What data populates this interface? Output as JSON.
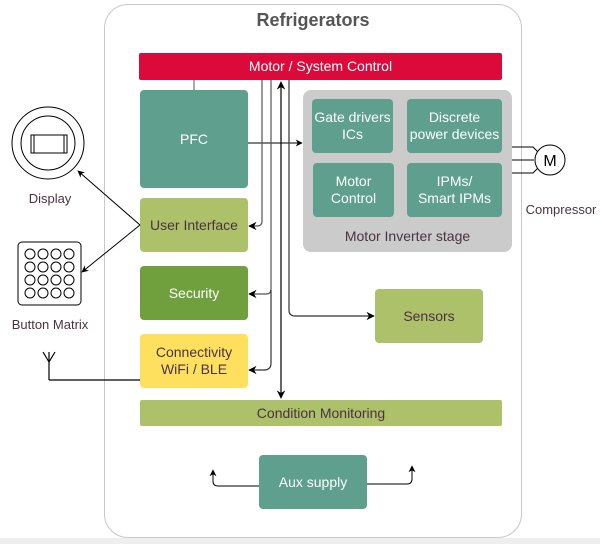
{
  "diagram": {
    "title": "Refrigerators",
    "blocks": {
      "motor_system_control": "Motor / System Control",
      "pfc": "PFC",
      "user_interface": "User Interface",
      "security": "Security",
      "connectivity_line1": "Connectivity",
      "connectivity_line2": "WiFi / BLE",
      "condition_monitoring": "Condition Monitoring",
      "sensors": "Sensors",
      "aux_supply": "Aux supply",
      "motor_inverter_stage": "Motor Inverter stage",
      "gate_drivers_line1": "Gate drivers",
      "gate_drivers_line2": "ICs",
      "discrete_line1": "Discrete",
      "discrete_line2": "power devices",
      "motor_control_line1": "Motor",
      "motor_control_line2": "Control",
      "ipms_line1": "IPMs/",
      "ipms_line2": "Smart IPMs"
    },
    "external": {
      "display": "Display",
      "button_matrix": "Button Matrix",
      "compressor": "Compressor",
      "motor_symbol": "M"
    },
    "colors": {
      "control_red": "#dc0a3a",
      "teal": "#5e9f8d",
      "olive": "#adc06a",
      "green": "#70a03e",
      "yellow": "#ffdf5e",
      "stage_gray": "#cbcbcb"
    }
  }
}
